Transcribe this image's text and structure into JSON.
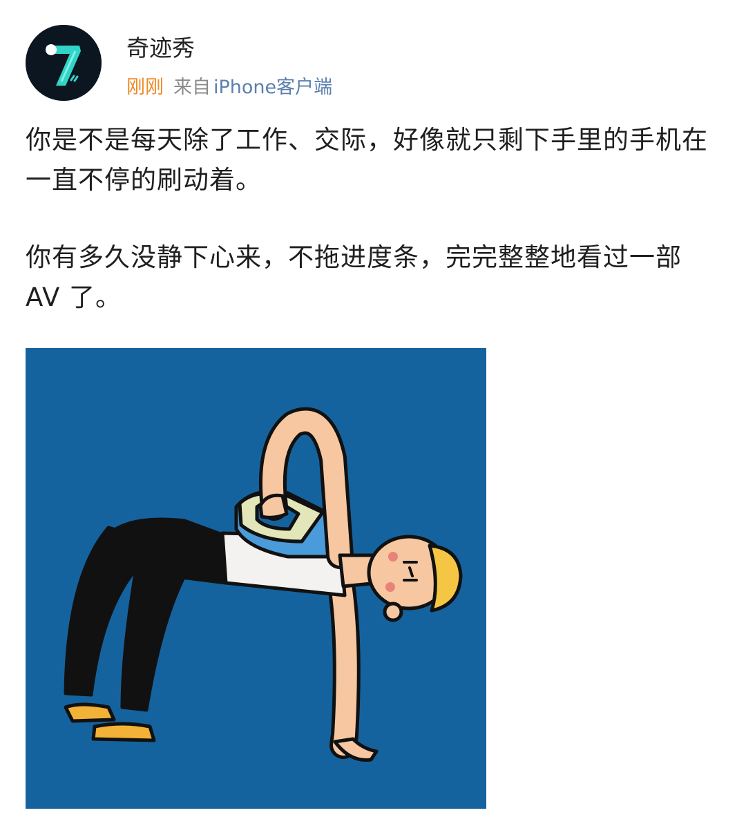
{
  "post": {
    "author": {
      "name": "奇迹秀",
      "avatar_icon": "seven-logo-icon",
      "avatar_bg": "#0c1621",
      "avatar_accent": "#2fd6c9"
    },
    "time": "刚刚",
    "source_prefix": "来自",
    "source_client": "iPhone客户端",
    "paragraphs": [
      "你是不是每天除了工作、交际，好像就只剩下手里的手机在一直不停的刷动着。",
      "你有多久没静下心来，不拖进度条，完完整整地看过一部 AV 了。"
    ],
    "image": {
      "icon": "person-ironing-back-illustration",
      "background": "#15639e"
    }
  }
}
